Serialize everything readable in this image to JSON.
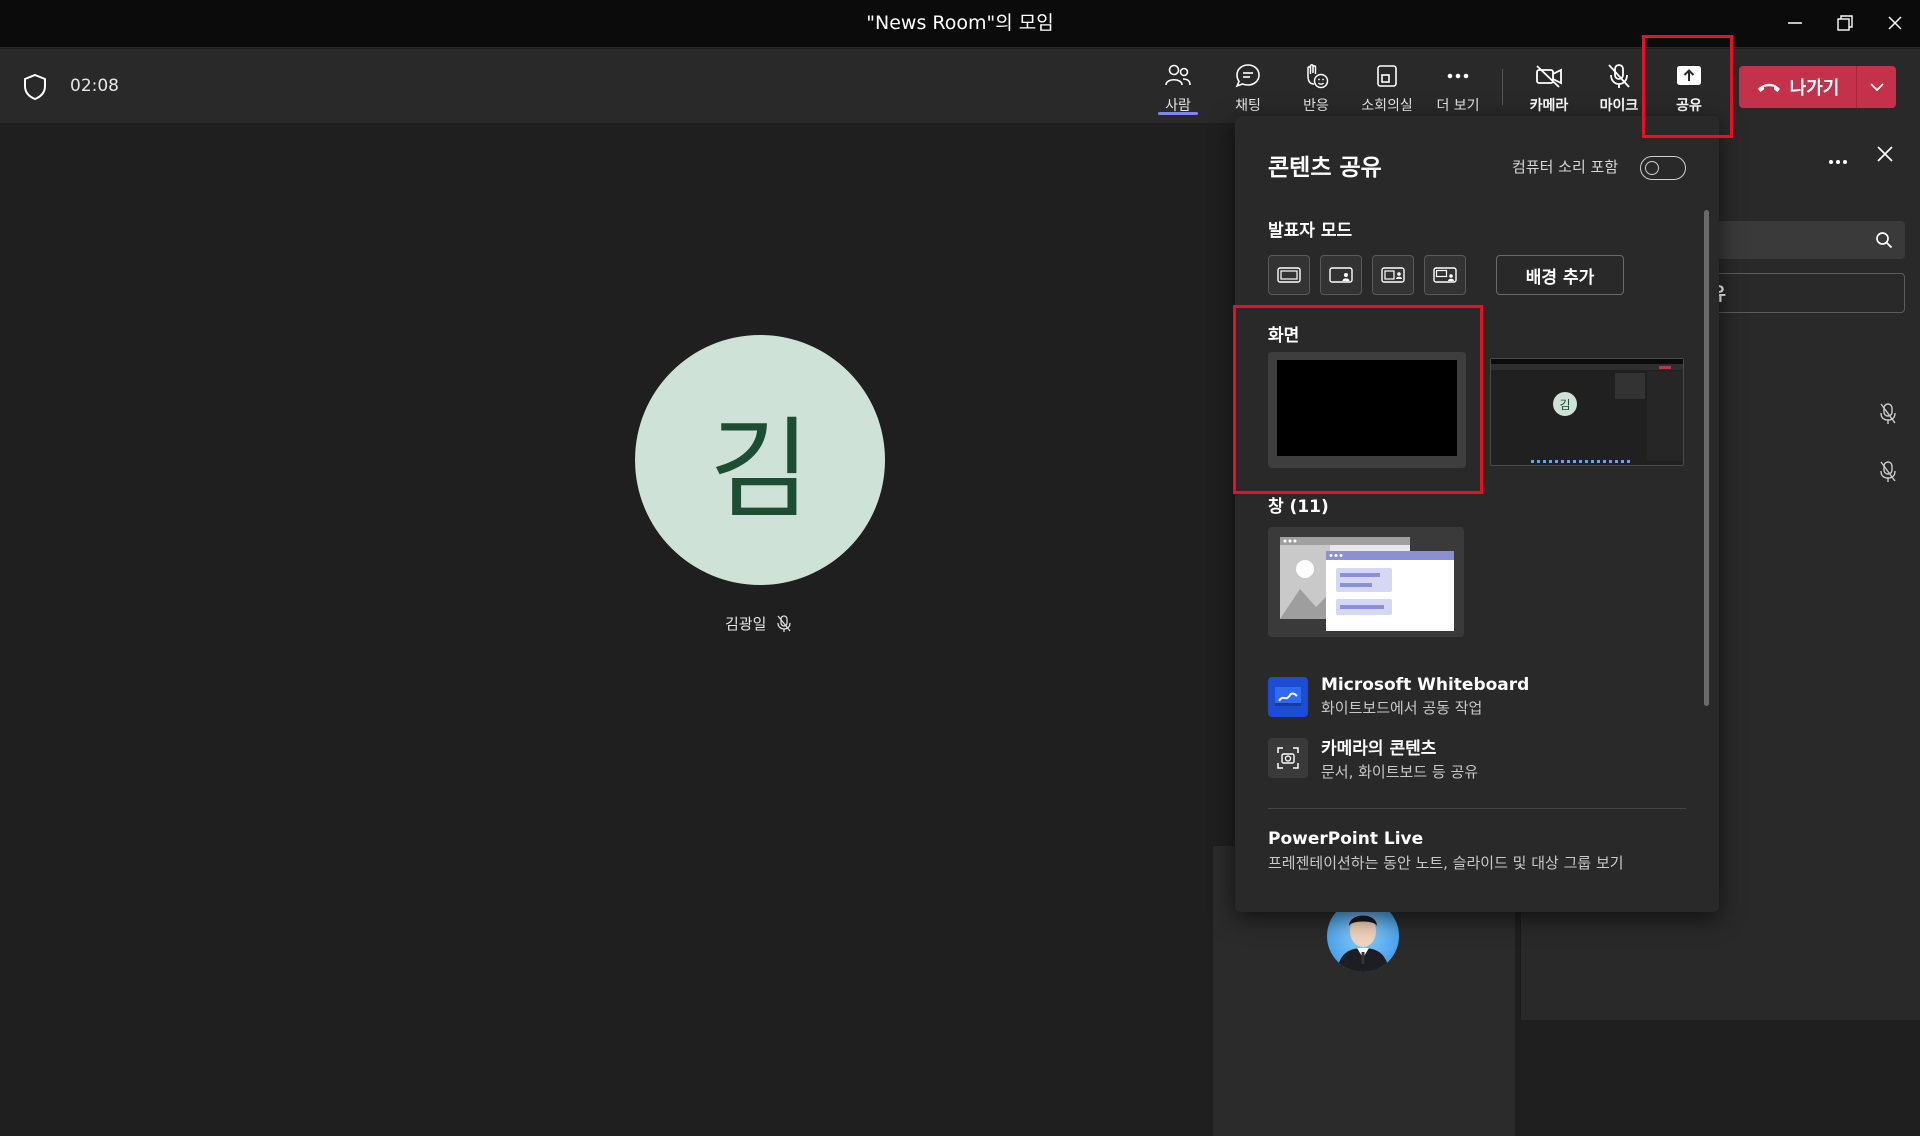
{
  "window": {
    "title": "\"News Room\"의 모임"
  },
  "toolbar": {
    "timer": "02:08",
    "buttons": [
      {
        "label": "사람",
        "icon": "people-icon",
        "active": true
      },
      {
        "label": "채팅",
        "icon": "chat-icon"
      },
      {
        "label": "반응",
        "icon": "reaction-icon"
      },
      {
        "label": "소회의실",
        "icon": "breakout-rooms-icon"
      },
      {
        "label": "더 보기",
        "icon": "more-icon"
      },
      {
        "label": "카메라",
        "icon": "camera-off-icon"
      },
      {
        "label": "마이크",
        "icon": "mic-off-icon"
      },
      {
        "label": "공유",
        "icon": "share-icon"
      }
    ],
    "leave_label": "나가기"
  },
  "stage": {
    "avatar_initial": "김",
    "participant_name": "김광일"
  },
  "side_panel": {
    "invite_label": "대 공유"
  },
  "share_popup": {
    "title": "콘텐츠 공유",
    "include_sound_label": "컴퓨터 소리 포함",
    "include_sound_on": false,
    "presenter_mode_label": "발표자 모드",
    "background_button": "배경 추가",
    "screen_label": "화면",
    "window_label": "창 (11)",
    "screen_thumb_initial": "김",
    "apps": [
      {
        "name": "Microsoft Whiteboard",
        "desc": "화이트보드에서 공동 작업",
        "icon": "whiteboard-icon"
      },
      {
        "name": "카메라의 콘텐츠",
        "desc": "문서, 화이트보드 등 공유",
        "icon": "camera-content-icon"
      }
    ],
    "powerpoint": {
      "name": "PowerPoint Live",
      "desc": "프레젠테이션하는 동안 노트, 슬라이드 및 대상 그룹 보기"
    }
  },
  "colors": {
    "accent": "#7f85f5",
    "leave": "#c4314b",
    "highlight": "#e81123",
    "avatar_bg": "#cfe2d7"
  }
}
